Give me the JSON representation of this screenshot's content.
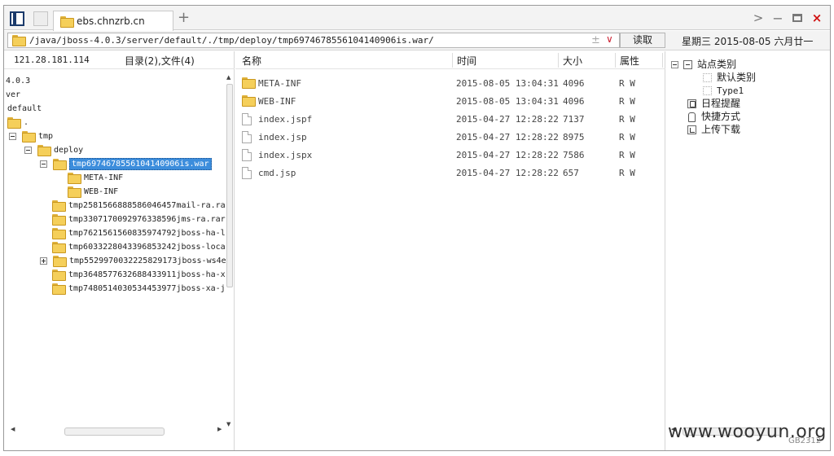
{
  "window": {
    "tab_title": "ebs.chnzrb.cn",
    "new_tab_label": "+",
    "nav_forward": ">",
    "minimize": "−",
    "close": "×"
  },
  "address": {
    "path": "/java/jboss-4.0.3/server/default/./tmp/deploy/tmp6974678556104140906is.war/",
    "plus_minus": "±",
    "dropdown": "∨",
    "read_button": "读取"
  },
  "date_bar": "星期三  2015-08-05  六月廿一",
  "left": {
    "ip": "121.28.181.114",
    "dir_count": "目录(2),文件(4)",
    "tree": [
      {
        "label": "4.0.3"
      },
      {
        "label": "ver"
      },
      {
        "label": "default"
      },
      {
        "label": "."
      },
      {
        "label": "tmp"
      },
      {
        "label": "deploy"
      },
      {
        "label": "tmp6974678556104140906is.war"
      },
      {
        "label": "META-INF"
      },
      {
        "label": "WEB-INF"
      },
      {
        "label": "tmp2581566888586046457mail-ra.ra"
      },
      {
        "label": "tmp3307170092976338596jms-ra.rar"
      },
      {
        "label": "tmp7621561560835974792jboss-ha-l"
      },
      {
        "label": "tmp6033228043396853242jboss-loca"
      },
      {
        "label": "tmp5529970032225829173jboss-ws4e"
      },
      {
        "label": "tmp3648577632688433911jboss-ha-x"
      },
      {
        "label": "tmp7480514030534453977jboss-xa-j"
      }
    ]
  },
  "files": {
    "columns": {
      "name": "名称",
      "time": "时间",
      "size": "大小",
      "attr": "属性"
    },
    "rows": [
      {
        "name": "META-INF",
        "time": "2015-08-05 13:04:31",
        "size": "4096",
        "attr": "R W",
        "type": "folder"
      },
      {
        "name": "WEB-INF",
        "time": "2015-08-05 13:04:31",
        "size": "4096",
        "attr": "R W",
        "type": "folder"
      },
      {
        "name": "index.jspf",
        "time": "2015-04-27 12:28:22",
        "size": "7137",
        "attr": "R W",
        "type": "file"
      },
      {
        "name": "index.jsp",
        "time": "2015-04-27 12:28:22",
        "size": "8975",
        "attr": "R W",
        "type": "file"
      },
      {
        "name": "index.jspx",
        "time": "2015-04-27 12:28:22",
        "size": "7586",
        "attr": "R W",
        "type": "file"
      },
      {
        "name": "cmd.jsp",
        "time": "2015-04-27 12:28:22",
        "size": "657",
        "attr": "R W",
        "type": "file"
      }
    ]
  },
  "right": {
    "items": [
      {
        "label": "站点类别"
      },
      {
        "label": "默认类别"
      },
      {
        "label": "Type1"
      },
      {
        "label": "日程提醒"
      },
      {
        "label": "快捷方式"
      },
      {
        "label": "上传下载"
      }
    ]
  },
  "watermark": {
    "main": "www.wooyun.org",
    "sub": "GB2312"
  },
  "colors": {
    "selection": "#3c8ddc",
    "folder": "#f5cf5a",
    "close": "#d01010"
  }
}
